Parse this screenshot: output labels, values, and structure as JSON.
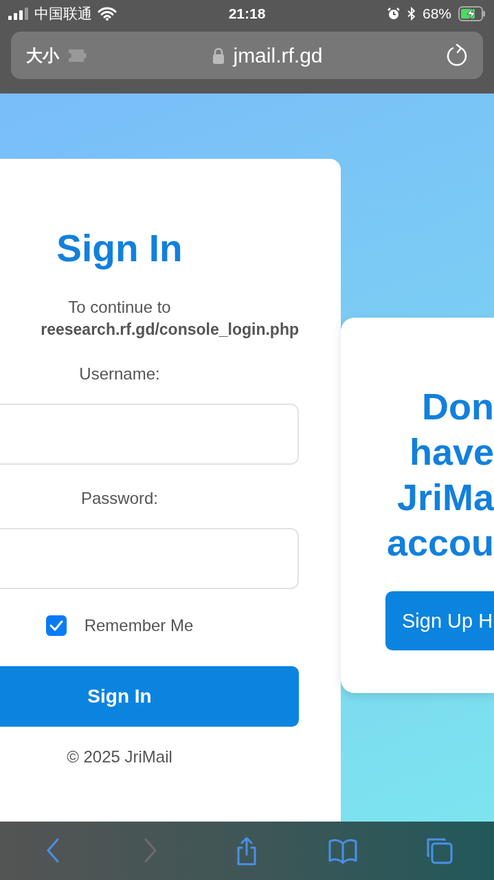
{
  "status_bar": {
    "carrier": "中国联通",
    "time": "21:18",
    "battery": "68%"
  },
  "address_bar": {
    "text_size": "大小",
    "url": "jmail.rf.gd"
  },
  "signin": {
    "title": "Sign In",
    "continue_label": "To continue to",
    "continue_url": "reesearch.rf.gd/console_login.php",
    "username_label": "Username:",
    "password_label": "Password:",
    "remember": {
      "label": "Remember Me",
      "checked": true
    },
    "button": "Sign In",
    "footer": "© 2025 JriMail"
  },
  "signup": {
    "heading_lines": [
      "Don",
      "have",
      "JriMa",
      "accou"
    ],
    "button": "Sign Up H"
  },
  "toolbar": [
    {
      "kind": "back",
      "disabled": false
    },
    {
      "kind": "forward",
      "disabled": true
    },
    {
      "kind": "share",
      "disabled": false
    },
    {
      "kind": "bookmarks",
      "disabled": false
    },
    {
      "kind": "tabs",
      "disabled": false
    }
  ]
}
